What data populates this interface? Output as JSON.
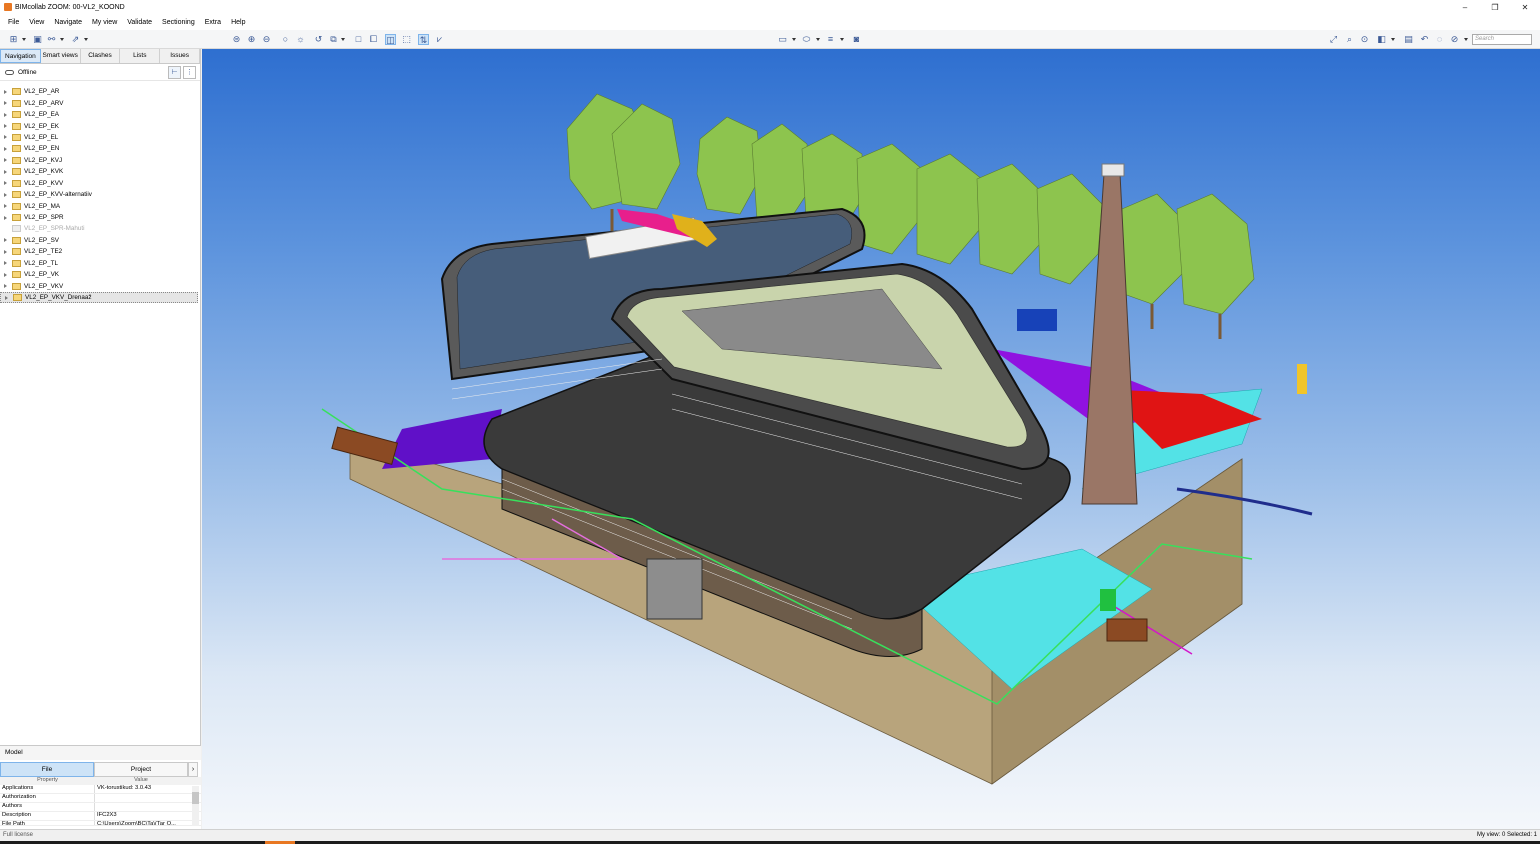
{
  "window": {
    "title": "BIMcollab ZOOM: 00-VL2_KOOND",
    "controls": [
      "–",
      "❐",
      "✕"
    ]
  },
  "menu": [
    "File",
    "View",
    "Navigate",
    "My view",
    "Validate",
    "Sectioning",
    "Extra",
    "Help"
  ],
  "toolbar": {
    "search_placeholder": "Search"
  },
  "left_panel": {
    "tabs": [
      "Navigation",
      "Smart views",
      "Clashes",
      "Lists",
      "Issues"
    ],
    "active_tab": "Navigation",
    "status": "Offline",
    "tree": [
      {
        "label": "VL2_EP_AR"
      },
      {
        "label": "VL2_EP_ARV"
      },
      {
        "label": "VL2_EP_EA"
      },
      {
        "label": "VL2_EP_EK"
      },
      {
        "label": "VL2_EP_EL"
      },
      {
        "label": "VL2_EP_EN"
      },
      {
        "label": "VL2_EP_KVJ"
      },
      {
        "label": "VL2_EP_KVK"
      },
      {
        "label": "VL2_EP_KVV"
      },
      {
        "label": "VL2_EP_KVV-alternatiiv"
      },
      {
        "label": "VL2_EP_MA"
      },
      {
        "label": "VL2_EP_SPR"
      },
      {
        "label": "VL2_EP_SPR-Mahuti"
      },
      {
        "label": "VL2_EP_SV"
      },
      {
        "label": "VL2_EP_TE2"
      },
      {
        "label": "VL2_EP_TL"
      },
      {
        "label": "VL2_EP_VK"
      },
      {
        "label": "VL2_EP_VKV"
      },
      {
        "label": "VL2_EP_VKV_Drenaaž"
      }
    ]
  },
  "model_panel": {
    "title": "Model",
    "tabs": [
      "File",
      "Project"
    ],
    "arrow": "›",
    "columns": [
      "Property",
      "Value"
    ],
    "rows": [
      {
        "name": "Applications",
        "value": "VK-torustikud: 3.0.43"
      },
      {
        "name": "Authorization",
        "value": ""
      },
      {
        "name": "Authors",
        "value": ""
      },
      {
        "name": "Description",
        "value": "IFC2X3"
      },
      {
        "name": "File Path",
        "value": "C:\\Users\\Zoom\\BC\\Ta\\(Tar O..."
      }
    ]
  },
  "statusbar": {
    "left": "Full license",
    "right": "My view: 0  Selected: 1"
  },
  "colors": {
    "accent": "#7eb4ea",
    "sky_top": "#2e6fd0",
    "sky_bottom": "#f4f7fb",
    "tree_green": "#8dc44e",
    "ground": "#b8a47c"
  }
}
